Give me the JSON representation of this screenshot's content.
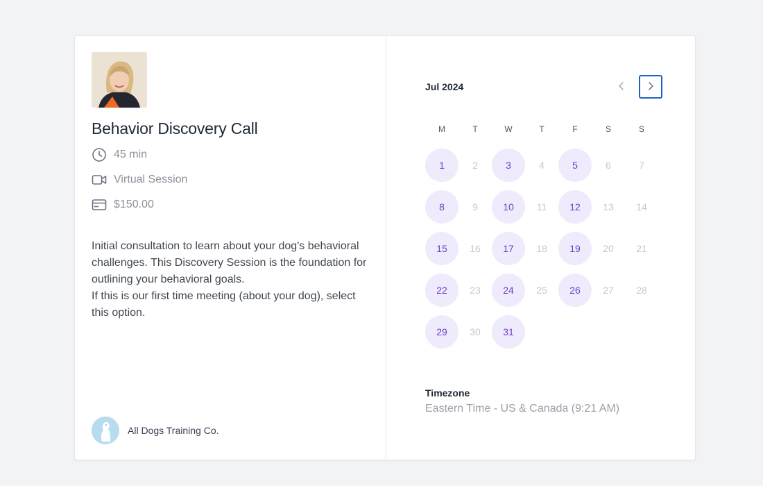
{
  "event": {
    "title": "Behavior Discovery Call",
    "duration": "45 min",
    "location": "Virtual Session",
    "price": "$150.00",
    "description": [
      "Initial consultation to learn about your dog's behavioral challenges. This Discovery Session is the foundation for outlining your behavioral goals.",
      "If this is our first time meeting (about your dog), select this option."
    ]
  },
  "icons": {
    "duration": "clock-icon",
    "location": "video-camera-icon",
    "price": "credit-card-icon",
    "prev": "chevron-left-icon",
    "next": "chevron-right-icon"
  },
  "organization": {
    "name": "All Dogs Training Co."
  },
  "calendar": {
    "month": "Jul 2024",
    "weekdays": [
      "M",
      "T",
      "W",
      "T",
      "F",
      "S",
      "S"
    ],
    "days": [
      {
        "label": "1",
        "available": true
      },
      {
        "label": "2",
        "available": false
      },
      {
        "label": "3",
        "available": true
      },
      {
        "label": "4",
        "available": false
      },
      {
        "label": "5",
        "available": true
      },
      {
        "label": "6",
        "available": false
      },
      {
        "label": "7",
        "available": false
      },
      {
        "label": "8",
        "available": true
      },
      {
        "label": "9",
        "available": false
      },
      {
        "label": "10",
        "available": true
      },
      {
        "label": "11",
        "available": false
      },
      {
        "label": "12",
        "available": true
      },
      {
        "label": "13",
        "available": false
      },
      {
        "label": "14",
        "available": false
      },
      {
        "label": "15",
        "available": true
      },
      {
        "label": "16",
        "available": false
      },
      {
        "label": "17",
        "available": true
      },
      {
        "label": "18",
        "available": false
      },
      {
        "label": "19",
        "available": true
      },
      {
        "label": "20",
        "available": false
      },
      {
        "label": "21",
        "available": false
      },
      {
        "label": "22",
        "available": true
      },
      {
        "label": "23",
        "available": false
      },
      {
        "label": "24",
        "available": true
      },
      {
        "label": "25",
        "available": false
      },
      {
        "label": "26",
        "available": true
      },
      {
        "label": "27",
        "available": false
      },
      {
        "label": "28",
        "available": false
      },
      {
        "label": "29",
        "available": true
      },
      {
        "label": "30",
        "available": false
      },
      {
        "label": "31",
        "available": true
      }
    ]
  },
  "timezone": {
    "label": "Timezone",
    "value": "Eastern Time - US & Canada (9:21 AM)"
  },
  "colors": {
    "available_bg": "#efeafc",
    "available_text": "#6d3fc5",
    "focus_ring": "#1e62c7"
  }
}
